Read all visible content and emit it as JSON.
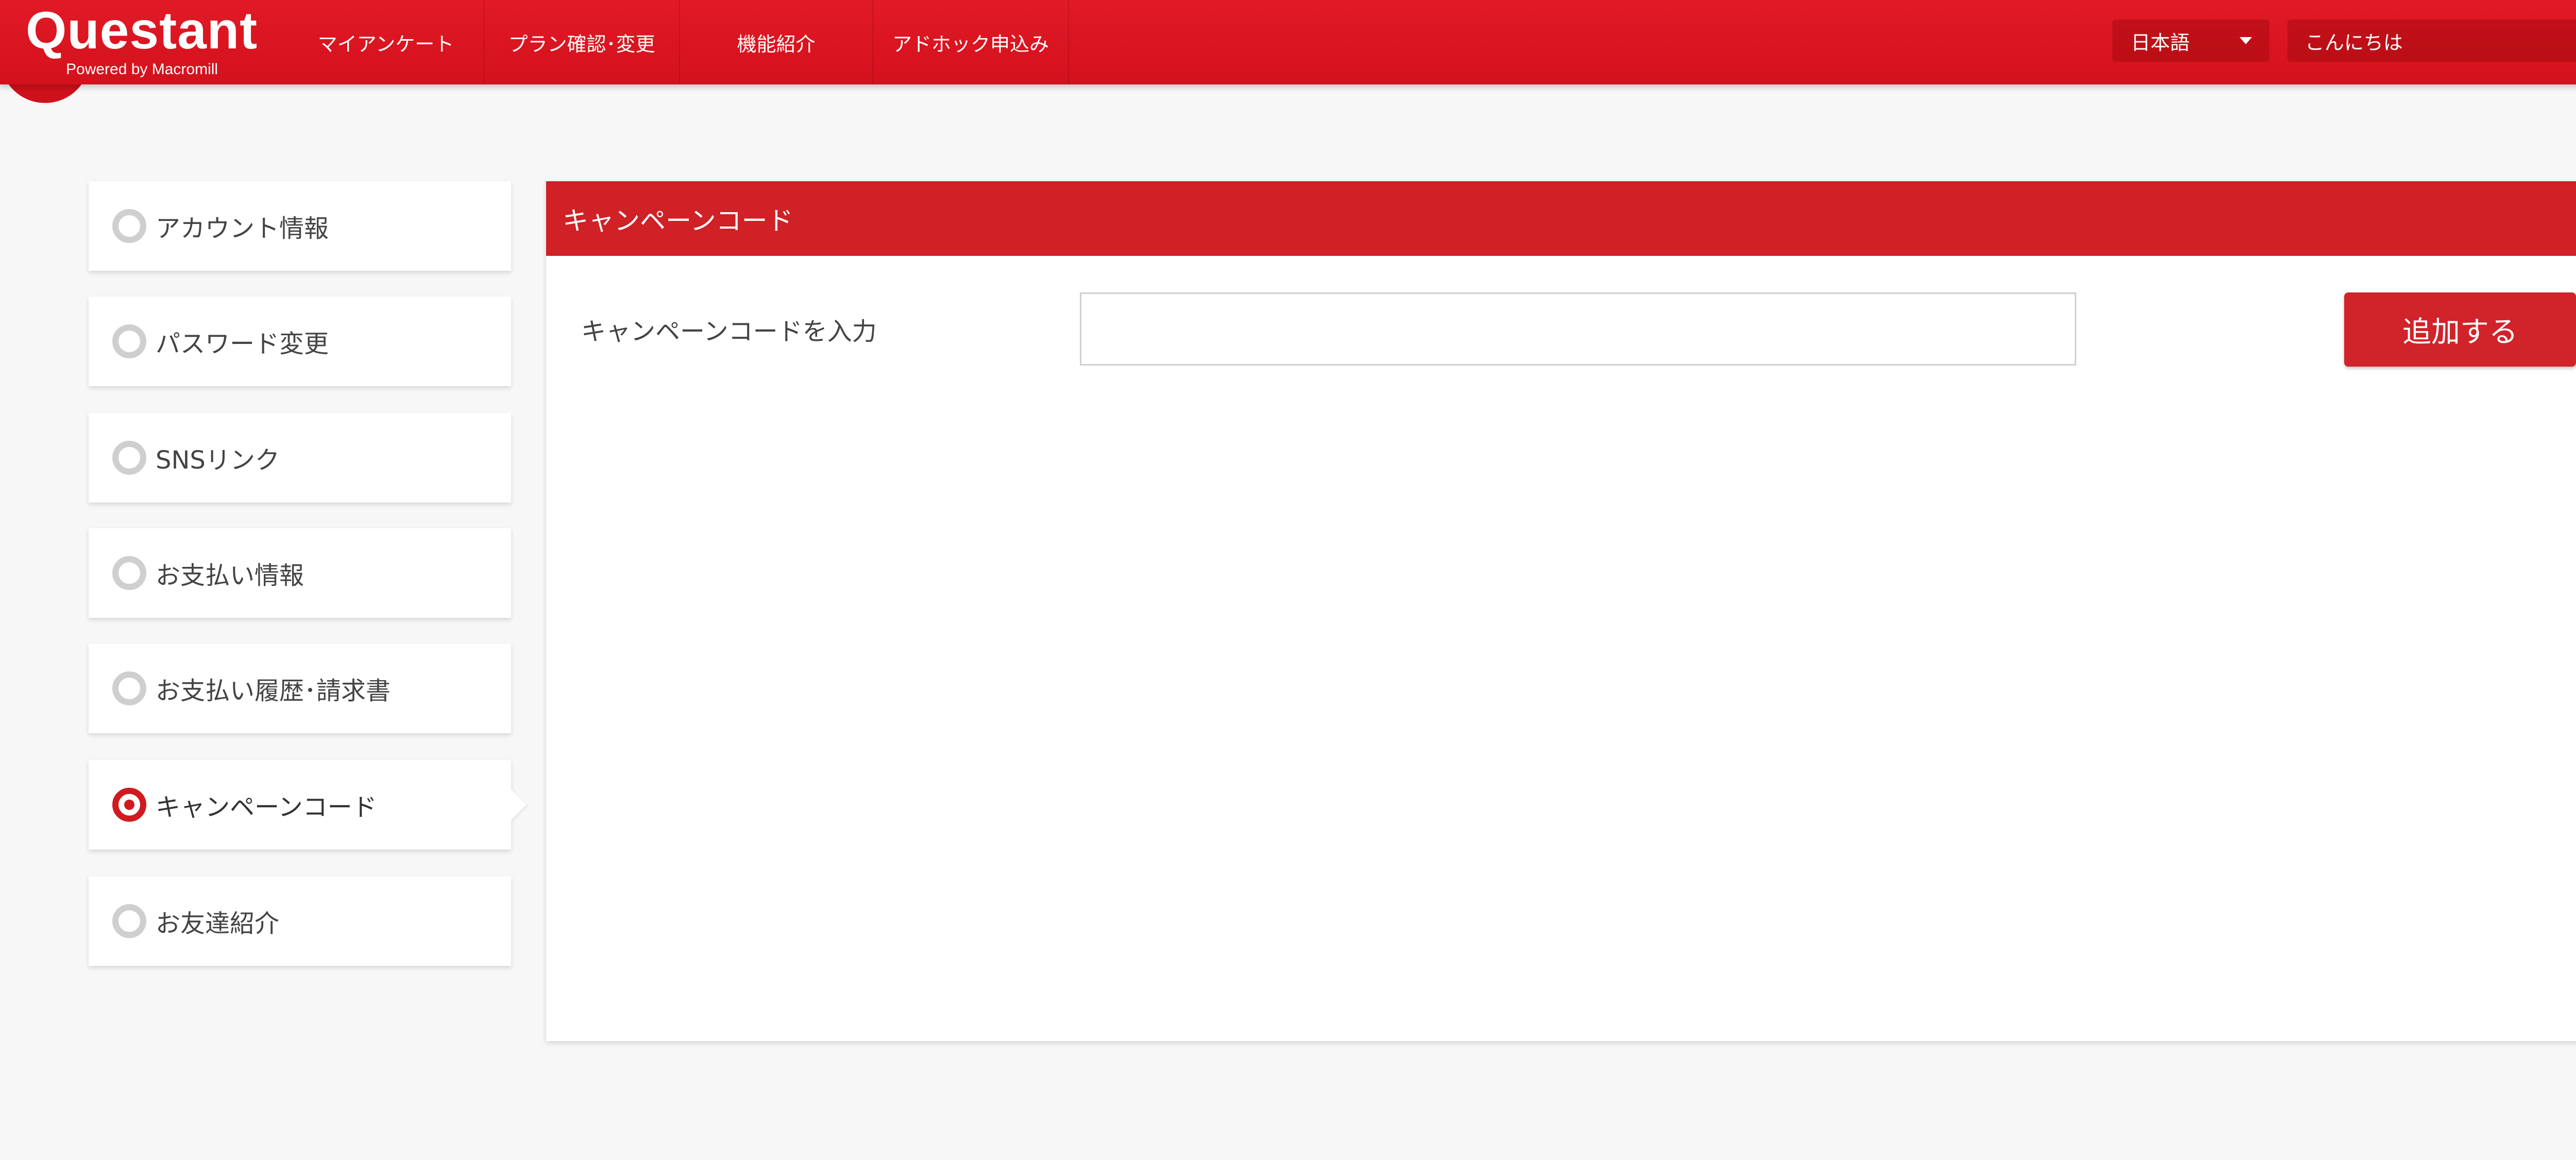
{
  "brand": {
    "logo": "Questant",
    "tagline": "Powered by Macromill"
  },
  "nav": {
    "items": [
      {
        "label": "マイアンケート"
      },
      {
        "label": "プラン確認･変更"
      },
      {
        "label": "機能紹介"
      },
      {
        "label": "アドホック申込み"
      }
    ]
  },
  "header": {
    "language": "日本語",
    "greeting": "こんにちは",
    "help": "?"
  },
  "sidebar": {
    "items": [
      {
        "label": "アカウント情報",
        "active": false
      },
      {
        "label": "パスワード変更",
        "active": false
      },
      {
        "label": "SNSリンク",
        "active": false
      },
      {
        "label": "お支払い情報",
        "active": false
      },
      {
        "label": "お支払い履歴･請求書",
        "active": false
      },
      {
        "label": "キャンペーンコード",
        "active": true
      },
      {
        "label": "お友達紹介",
        "active": false
      }
    ]
  },
  "main": {
    "title": "キャンペーンコード",
    "field_label": "キャンペーンコードを入力",
    "input_value": "",
    "add_button": "追加する"
  },
  "colors": {
    "header_red": "#d8121e",
    "panel_head_red": "#cf2126",
    "active_radio": "#cf1a20"
  }
}
